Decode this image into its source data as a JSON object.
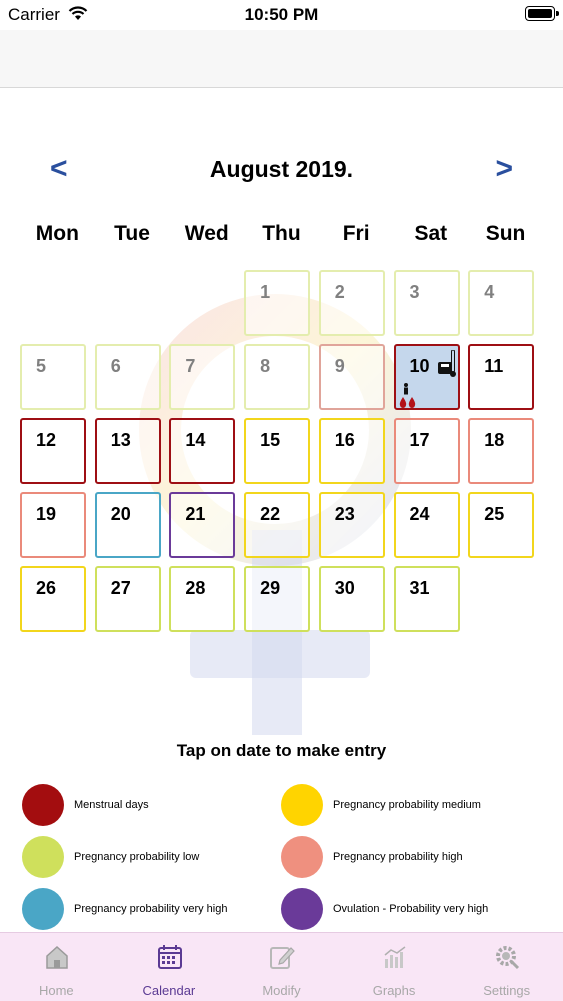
{
  "status": {
    "carrier": "Carrier",
    "time": "10:50 PM"
  },
  "calendar": {
    "prev": "<",
    "next": ">",
    "title": "August 2019.",
    "weekdays": [
      "Mon",
      "Tue",
      "Wed",
      "Thu",
      "Fri",
      "Sat",
      "Sun"
    ],
    "days": [
      {
        "day": "1",
        "type": "low",
        "faded": true
      },
      {
        "day": "2",
        "type": "low",
        "faded": true
      },
      {
        "day": "3",
        "type": "low",
        "faded": true
      },
      {
        "day": "4",
        "type": "low",
        "faded": true
      },
      {
        "day": "5",
        "type": "low",
        "faded": true
      },
      {
        "day": "6",
        "type": "low",
        "faded": true
      },
      {
        "day": "7",
        "type": "low",
        "faded": true
      },
      {
        "day": "8",
        "type": "low",
        "faded": true
      },
      {
        "day": "9",
        "type": "high",
        "faded": true
      },
      {
        "day": "10",
        "type": "menstrual",
        "selected": true,
        "icons": [
          "scale-icon",
          "thermometer-icon",
          "person-icon",
          "blood-drops-icon"
        ]
      },
      {
        "day": "11",
        "type": "menstrual"
      },
      {
        "day": "12",
        "type": "menstrual"
      },
      {
        "day": "13",
        "type": "menstrual"
      },
      {
        "day": "14",
        "type": "menstrual"
      },
      {
        "day": "15",
        "type": "medium"
      },
      {
        "day": "16",
        "type": "medium"
      },
      {
        "day": "17",
        "type": "high"
      },
      {
        "day": "18",
        "type": "high"
      },
      {
        "day": "19",
        "type": "high"
      },
      {
        "day": "20",
        "type": "veryhigh"
      },
      {
        "day": "21",
        "type": "ovulation"
      },
      {
        "day": "22",
        "type": "medium"
      },
      {
        "day": "23",
        "type": "medium"
      },
      {
        "day": "24",
        "type": "medium"
      },
      {
        "day": "25",
        "type": "medium"
      },
      {
        "day": "26",
        "type": "medium"
      },
      {
        "day": "27",
        "type": "low"
      },
      {
        "day": "28",
        "type": "low"
      },
      {
        "day": "29",
        "type": "low"
      },
      {
        "day": "30",
        "type": "low"
      },
      {
        "day": "31",
        "type": "low"
      }
    ]
  },
  "instruction": "Tap on date to make entry",
  "legend": [
    {
      "label": "Menstrual days",
      "color": "#a30d0f"
    },
    {
      "label": "Pregnancy probability medium",
      "color": "#ffd400"
    },
    {
      "label": "Pregnancy probability low",
      "color": "#cfe05c"
    },
    {
      "label": "Pregnancy probability high",
      "color": "#ef907f"
    },
    {
      "label": "Pregnancy probability very high",
      "color": "#4aa6c6"
    },
    {
      "label": "Ovulation - Probability very high",
      "color": "#6a3a99"
    }
  ],
  "colors": {
    "menstrual": "#9e0f14",
    "low": "#cfe05c",
    "medium": "#f2d61c",
    "high": "#ea8a7b",
    "veryhigh": "#4aa6c6",
    "ovulation": "#6a3a99",
    "nav_arrow": "#2a4f9e",
    "tab_active": "#5b3a93",
    "tabbar_bg": "#f9e6f6"
  },
  "tabs": [
    {
      "label": "Home",
      "icon": "house-icon",
      "active": false
    },
    {
      "label": "Calendar",
      "icon": "calendar-icon",
      "active": true
    },
    {
      "label": "Modify",
      "icon": "edit-icon",
      "active": false
    },
    {
      "label": "Graphs",
      "icon": "graph-icon",
      "active": false
    },
    {
      "label": "Settings",
      "icon": "gear-icon",
      "active": false
    }
  ]
}
